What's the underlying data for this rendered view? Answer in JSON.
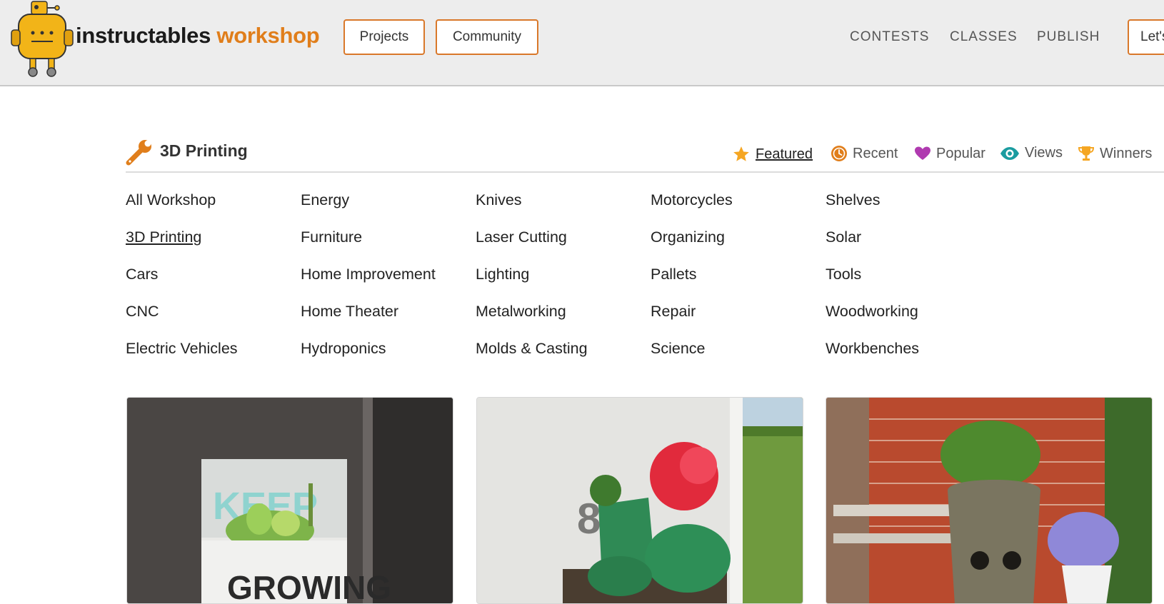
{
  "header": {
    "brand_part1": "instructables",
    "brand_part2": "workshop",
    "nav_buttons": [
      "Projects",
      "Community"
    ],
    "nav_links": [
      "CONTESTS",
      "CLASSES",
      "PUBLISH"
    ],
    "cta_label": "Let's"
  },
  "category": {
    "title": "3D Printing",
    "sort_options": [
      {
        "label": "Featured",
        "icon": "star-icon",
        "color": "#f5a623",
        "active": true
      },
      {
        "label": "Recent",
        "icon": "clock-icon",
        "color": "#e07e1b"
      },
      {
        "label": "Popular",
        "icon": "heart-icon",
        "color": "#b03ab0"
      },
      {
        "label": "Views",
        "icon": "eye-icon",
        "color": "#1a9ca0"
      },
      {
        "label": "Winners",
        "icon": "trophy-icon",
        "color": "#f5a623"
      }
    ]
  },
  "categories": [
    [
      "All Workshop",
      "3D Printing",
      "Cars",
      "CNC",
      "Electric Vehicles"
    ],
    [
      "Energy",
      "Furniture",
      "Home Improvement",
      "Home Theater",
      "Hydroponics"
    ],
    [
      "Knives",
      "Laser Cutting",
      "Lighting",
      "Metalworking",
      "Molds & Casting"
    ],
    [
      "Motorcycles",
      "Organizing",
      "Pallets",
      "Repair",
      "Science"
    ],
    [
      "Shelves",
      "Solar",
      "Tools",
      "Woodworking",
      "Workbenches"
    ]
  ],
  "active_category": "3D Printing",
  "cards": [
    {
      "image": "printed-planter-keep-growing"
    },
    {
      "image": "printed-boot-planter-flower"
    },
    {
      "image": "printed-groot-planter"
    }
  ],
  "card_text": {
    "keep": "KEEP",
    "growing": "GROWING"
  },
  "colors": {
    "accent": "#e07e1b",
    "header_bg": "#ededed"
  }
}
